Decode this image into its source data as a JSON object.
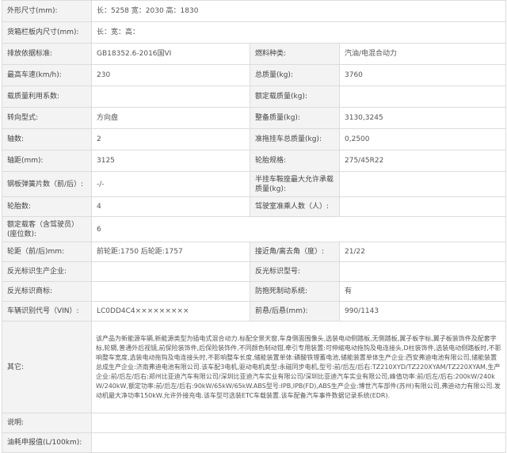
{
  "specs": {
    "dims_label": "外形尺寸(mm):",
    "dims_value": "长：5258 宽：2030 高：1830",
    "cargo_label": "货箱栏板内尺寸(mm):",
    "cargo_value": "长：宽：高：",
    "emission_label": "排放依据标准:",
    "emission_value": "GB18352.6-2016国VI",
    "fuel_label": "燃料种类:",
    "fuel_value": "汽油/电混合动力",
    "speed_label": "最高车速(km/h):",
    "speed_value": "230",
    "total_mass_label": "总质量(kg):",
    "total_mass_value": "3760",
    "payload_util_label": "载质量利用系数:",
    "payload_util_value": "",
    "rated_load_label": "额定载质量(kg):",
    "rated_load_value": "",
    "steering_label": "转向型式:",
    "steering_value": "方向盘",
    "curb_mass_label": "整备质量(kg):",
    "curb_mass_value": "3130,3245",
    "axles_label": "轴数:",
    "axles_value": "2",
    "trailer_mass_label": "准拖挂车总质量(kg):",
    "trailer_mass_value": "0,2500",
    "wheelbase_label": "轴距(mm):",
    "wheelbase_value": "3125",
    "tire_label": "轮胎规格:",
    "tire_value": "275/45R22",
    "leaf_label": "钢板弹簧片数（前/后）:",
    "leaf_value": "-/-",
    "saddle_label": "半挂车鞍座最大允许承载质量(kg):",
    "saddle_value": "",
    "tire_count_label": "轮胎数:",
    "tire_count_value": "4",
    "cab_label": "驾驶室准乘人数（人）:",
    "cab_value": "",
    "passengers_label": "额定载客（含驾驶员）(座位数):",
    "passengers_value": "6",
    "track_label": "轮距（前/后)mm:",
    "track_value": "前轮距:1750 后轮距:1757",
    "angle_label": "接近角/离去角（度）:",
    "angle_value": "21/22",
    "reflector_maker_label": "反光标识生产企业:",
    "reflector_maker_value": "",
    "reflector_model_label": "反光标识型号:",
    "reflector_model_value": "",
    "reflector_brand_label": "反光标识商标:",
    "reflector_brand_value": "",
    "abs_label": "防抱死制动系统:",
    "abs_value": "有",
    "vin_label": "车辆识别代号（VIN）:",
    "vin_value": "LC0DD4C4×××××××××",
    "overhang_label": "前悬/后悬(mm):",
    "overhang_value": "990/1143",
    "other_label": "其它:",
    "other_value": "该产品为新能源车辆,新能源类型为插电式混合动力.标配全景天窗,车身侧面围像头,选装电动侧踏板,无侧踏板,翼子板字标,翼子板装饰件及配套字标,轮辋,普通外后视镜,前保险装饰件,后保险装饰件,不同颜色制动钳,牵引专用装置:可伸缩电动拖钩及电连接头,D柱装饰件,选装电动侧踏板时,不影响整车宽度,选装电动拖钩及电连接头时,不影响整车长度,储能装置单体:磷酸铁锂蓄电池,储能装置单体生产企业:西安弗迪电池有限公司,储能装置总成生产企业:济南弗迪电池有限公司.该车配3电机,驱动电机类型:永磁同步电机,型号:前/后左/后右:TZ210XYD/TZ220XYAM/TZ220XYAM,生产企业:前/后左/后右:郑州比亚迪汽车有限公司/深圳比亚迪汽车实业有限公司/深圳比亚迪汽车实业有限公司,峰值功率:前/后左/后右:200kW/240kW/240kW,额定功率:前/后左/后右:90kW/65kW/65kW.ABS型号:IPB,IPB(FD),ABS生产企业:博世汽车部件(苏州)有限公司,弗迪动力有限公司.发动机最大净功率150kW.允许外接充电.该车型可选装ETC车载装置.该车配备汽车事件数据记录系统(EDR).",
    "note_label": "说明:",
    "note_value": "",
    "fuel_report_label": "油耗申报值(L/100km):",
    "fuel_report_value": ""
  }
}
